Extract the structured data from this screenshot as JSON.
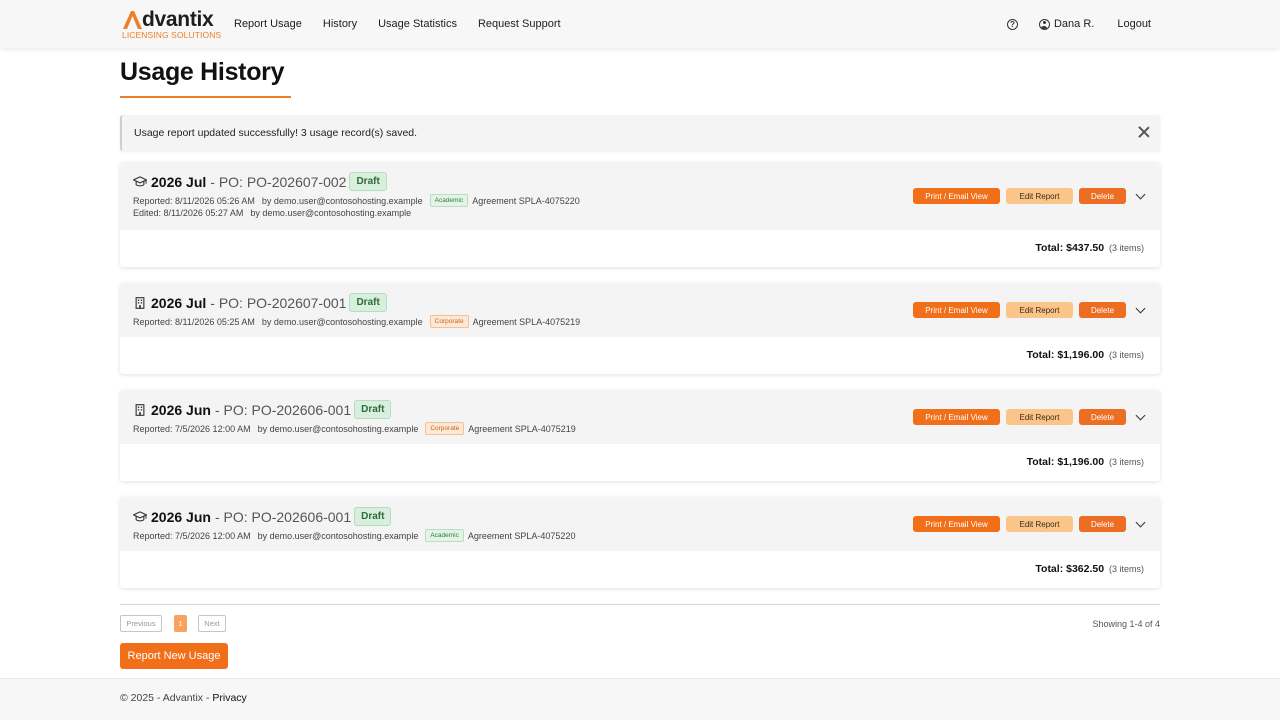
{
  "brand": {
    "name": "dvantix",
    "subtitle": "LICENSING SOLUTIONS",
    "accent": "#f07e26"
  },
  "nav": {
    "links": [
      "Report Usage",
      "History",
      "Usage Statistics",
      "Request Support"
    ],
    "help_icon": "question-circle-icon",
    "user_name": "Dana R.",
    "logout": "Logout"
  },
  "page": {
    "title": "Usage History"
  },
  "alert": {
    "text": "Usage report updated successfully! 3 usage record(s) saved."
  },
  "reports": [
    {
      "icon": "graduation-cap-icon",
      "period": "2026 Jul",
      "po": "- PO: PO-202607-002",
      "status": "Draft",
      "reported": "Reported: 8/11/2026 05:26 AM",
      "reported_by": "by demo.user@contosohosting.example",
      "tag": "Academic",
      "agreement": "Agreement SPLA-4075220",
      "edited": "Edited: 8/11/2026 05:27 AM",
      "edited_by": "by demo.user@contosohosting.example",
      "total": "Total: $437.50",
      "items": "(3 items)"
    },
    {
      "icon": "building-icon",
      "period": "2026 Jul",
      "po": "- PO: PO-202607-001",
      "status": "Draft",
      "reported": "Reported: 8/11/2026 05:25 AM",
      "reported_by": "by demo.user@contosohosting.example",
      "tag": "Corporate",
      "agreement": "Agreement SPLA-4075219",
      "total": "Total: $1,196.00",
      "items": "(3 items)"
    },
    {
      "icon": "building-icon",
      "period": "2026 Jun",
      "po": "- PO: PO-202606-001",
      "status": "Draft",
      "reported": "Reported: 7/5/2026 12:00 AM",
      "reported_by": "by demo.user@contosohosting.example",
      "tag": "Corporate",
      "agreement": "Agreement SPLA-4075219",
      "total": "Total: $1,196.00",
      "items": "(3 items)"
    },
    {
      "icon": "graduation-cap-icon",
      "period": "2026 Jun",
      "po": "- PO: PO-202606-001",
      "status": "Draft",
      "reported": "Reported: 7/5/2026 12:00 AM",
      "reported_by": "by demo.user@contosohosting.example",
      "tag": "Academic",
      "agreement": "Agreement SPLA-4075220",
      "total": "Total: $362.50",
      "items": "(3 items)"
    }
  ],
  "actions": {
    "print": "Print / Email View",
    "edit": "Edit Report",
    "delete": "Delete"
  },
  "pagination": {
    "previous": "Previous",
    "current": "1",
    "next": "Next",
    "showing": "Showing 1-4 of 4"
  },
  "new_report_button": "Report New Usage",
  "footer": {
    "text": "© 2025 - Advantix - ",
    "link": "Privacy"
  }
}
